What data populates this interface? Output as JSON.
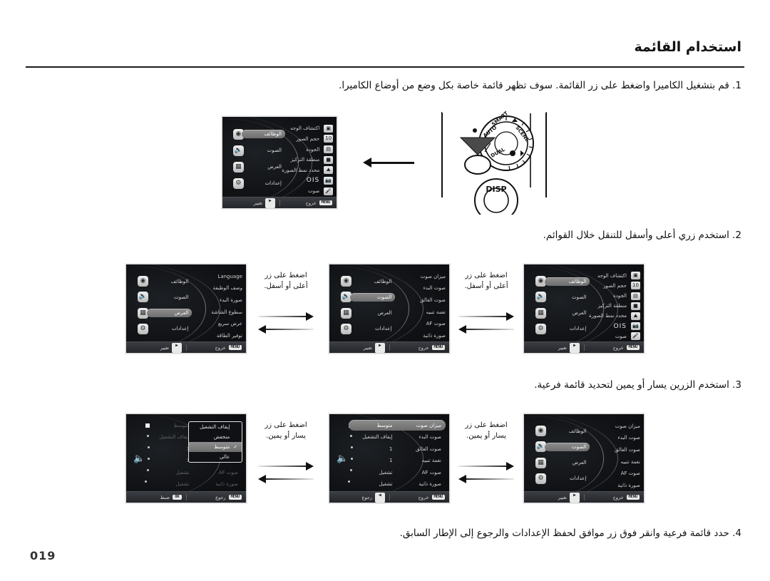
{
  "header": {
    "title": "استخدام القائمة"
  },
  "page_number": "019",
  "steps": {
    "step1": "1. قم بتشغيل الكاميرا واضغط على زر القائمة. سوف تظهر قائمة خاصة بكل وضع من أوضاع الكاميرا.",
    "step2": "2. استخدم زري أعلى وأسفل للتنقل خلال القوائم.",
    "step3": "3. استخدم الزرين يسار أو يمين لتحديد قائمة فرعية.",
    "step4": "4. حدد قائمة فرعية وانقر فوق زر موافق لحفظ الإعدادات والرجوع إلى الإطار السابق."
  },
  "captions": {
    "up_down": "اضغط على زر\nأعلى أو أسفل.",
    "up_down_line1": "اضغط على زر",
    "up_down_line2": "أعلى أو أسفل.",
    "left_right_line1": "اضغط على زر",
    "left_right_line2": "يسار أو يمين."
  },
  "categories": {
    "functions": "الوظائف",
    "sound": "الصوت",
    "display": "العرض",
    "settings": "إعدادات"
  },
  "bottom_bar": {
    "menu_key": "MENU",
    "exit": "خروج",
    "change": "تغيير",
    "back": "رجوع",
    "set": "ضبط",
    "ok_key": "OK",
    "arrow_right_key": "▶",
    "arrow_left_key": "◀"
  },
  "screens": {
    "function_menu": {
      "items": [
        {
          "icon": "face-detect-icon",
          "label": "اكتشاف الوجه"
        },
        {
          "icon": "photo-size-icon",
          "label": "حجم الصور"
        },
        {
          "icon": "quality-icon",
          "label": "الجودة"
        },
        {
          "icon": "focus-area-icon",
          "label": "منطقة التركيز"
        },
        {
          "icon": "photo-style-icon",
          "label": "محدد نمط الصورة"
        },
        {
          "icon": "ois-icon",
          "label": "OIS"
        },
        {
          "icon": "voice-icon",
          "label": "صوت"
        }
      ],
      "selected_category": "الوظائف"
    },
    "display_menu": {
      "items": [
        {
          "label": "Language"
        },
        {
          "label": "وصف الوظيفة"
        },
        {
          "label": "صورة البدء"
        },
        {
          "label": "سطوع الشاشة"
        },
        {
          "label": "عرض سريع"
        },
        {
          "label": "توفير الطاقة"
        }
      ],
      "selected_category": "العرض"
    },
    "sound_menu": {
      "items": [
        {
          "label": "ميزان صوت"
        },
        {
          "label": "صوت البدء"
        },
        {
          "label": "صوت الغالق"
        },
        {
          "label": "نغمة تنبيه"
        },
        {
          "label": "صوت AF"
        },
        {
          "label": "صورة ذاتية"
        }
      ],
      "selected_category": "الصوت"
    },
    "sound_submenu": {
      "rows": [
        {
          "label": "ميزان صوت",
          "value": "متوسط",
          "state": "selected"
        },
        {
          "label": "صوت البدء",
          "value": "إيقاف التشغيل",
          "state": "normal"
        },
        {
          "label": "صوت الغالق",
          "value": "1",
          "state": "normal"
        },
        {
          "label": "نغمة تنبيه",
          "value": "1",
          "state": "normal"
        },
        {
          "label": "صوت AF",
          "value": "تشغيل",
          "state": "normal"
        },
        {
          "label": "صورة ذاتية",
          "value": "تشغيل",
          "state": "normal"
        }
      ]
    },
    "sound_dropdown": {
      "options": [
        {
          "label": "إيقاف التشغيل",
          "checked": false
        },
        {
          "label": "منخفض",
          "checked": false
        },
        {
          "label": "متوسط",
          "checked": true
        },
        {
          "label": "عالي",
          "checked": false
        }
      ],
      "rows_behind": [
        {
          "label": "ميزان صوت",
          "value": "متوسط"
        },
        {
          "label": "صوت البدء",
          "value": "إيقاف التشغيل"
        },
        {
          "label": "صوت الغالق",
          "value": "1"
        },
        {
          "label": "نغمة تنبيه",
          "value": "1"
        },
        {
          "label": "صوت AF",
          "value": "تشغيل"
        },
        {
          "label": "صورة ذاتية",
          "value": "تشغيل"
        }
      ]
    }
  },
  "camera_photo": {
    "dial_labels": [
      "AUTO",
      "SMART",
      "SCENE",
      "DUAL"
    ],
    "button_label": "DISP"
  },
  "colors": {
    "page_background": "#ffffff",
    "text": "#111111",
    "lcd_background": "#0b0b0d",
    "lcd_highlight": "#7d7d7d",
    "lcd_bar": "#33363b"
  }
}
